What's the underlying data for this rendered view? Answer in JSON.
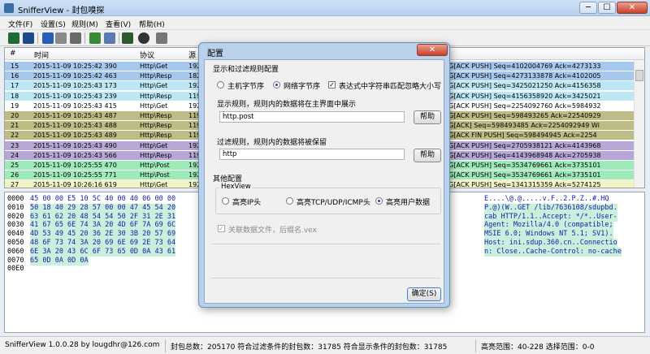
{
  "window": {
    "title": "SnifferView - 封包嗅探",
    "min": "─",
    "max": "☐",
    "close": "✕"
  },
  "menu": [
    "文件(F)",
    "设置(S)",
    "规则(M)",
    "查看(V)",
    "帮助(H)"
  ],
  "list": {
    "headers": {
      "no": "#",
      "time": "时间",
      "proto": "协议",
      "src": "源",
      "info": "内容"
    },
    "rows": [
      {
        "no": "15",
        "time": "2015-11-09 10:25:42 390",
        "proto": "Http\\Get",
        "src": "192",
        "info": "Tcp FLAG[ACK PUSH] Seq=4102004769 Ack=4273133",
        "bg": "#a6c8ee"
      },
      {
        "no": "16",
        "time": "2015-11-09 10:25:42 463",
        "proto": "Http\\Resp",
        "src": "182",
        "info": "Tcp FLAG[ACK PUSH] Seq=4273133878 Ack=4102005",
        "bg": "#a6c8ee"
      },
      {
        "no": "17",
        "time": "2015-11-09 10:25:43 173",
        "proto": "Http\\Get",
        "src": "192",
        "info": "Tcp FLAG[ACK PUSH] Seq=3425021250 Ack=4156358",
        "bg": "#bde7f5"
      },
      {
        "no": "18",
        "time": "2015-11-09 10:25:43 239",
        "proto": "Http\\Resp",
        "src": "119",
        "info": "Tcp FLAG[ACK PUSH] Seq=4156358920 Ack=3425021",
        "bg": "#bde7f5"
      },
      {
        "no": "19",
        "time": "2015-11-09 10:25:43 415",
        "proto": "Http\\Get",
        "src": "192",
        "info": "Tcp FLAG[ACK PUSH] Seq=2254092760 Ack=5984932",
        "bg": "#ffffff"
      },
      {
        "no": "20",
        "time": "2015-11-09 10:25:43 487",
        "proto": "Http\\Resp",
        "src": "119",
        "info": "Tcp FLAG[ACK PUSH] Seq=598493265 Ack=22540929",
        "bg": "#bdbc84"
      },
      {
        "no": "21",
        "time": "2015-11-09 10:25:43 488",
        "proto": "Http\\Resp",
        "src": "119",
        "info": "Tcp FLAG[ACK] Seq=598493485 Ack=2254092949 Wi",
        "bg": "#bdbc84"
      },
      {
        "no": "22",
        "time": "2015-11-09 10:25:43 489",
        "proto": "Http\\Resp",
        "src": "119",
        "info": "Tcp FLAG[ACK FIN PUSH] Seq=598494945 Ack=2254",
        "bg": "#bdbc84"
      },
      {
        "no": "23",
        "time": "2015-11-09 10:25:43 490",
        "proto": "Http\\Get",
        "src": "192",
        "info": "Tcp FLAG[ACK PUSH] Seq=2705938121 Ack=4143968",
        "bg": "#b6a7d6"
      },
      {
        "no": "24",
        "time": "2015-11-09 10:25:43 566",
        "proto": "Http\\Resp",
        "src": "119",
        "info": "Tcp FLAG[ACK PUSH] Seq=4143968948 Ack=2705938",
        "bg": "#b6a7d6"
      },
      {
        "no": "25",
        "time": "2015-11-09 10:25:55 470",
        "proto": "Http\\Post",
        "src": "192",
        "info": "Tcp FLAG[ACK PUSH] Seq=3534769661 Ack=3735101",
        "bg": "#9eeab9"
      },
      {
        "no": "26",
        "time": "2015-11-09 10:25:55 771",
        "proto": "Http\\Post",
        "src": "192",
        "info": "Tcp FLAG[ACK PUSH] Seq=3534769661 Ack=3735101",
        "bg": "#9eeab9"
      },
      {
        "no": "27",
        "time": "2015-11-09 10:26:16 619",
        "proto": "Http\\Get",
        "src": "192",
        "info": "Tcp FLAG[ACK PUSH] Seq=1341315359 Ack=5274125",
        "bg": "#f1f5c6"
      }
    ]
  },
  "hex": {
    "lines": [
      {
        "off": "0000",
        "bytes": "45 00 00 E5 10 5C 40 00 40 06 00 00",
        "ascii": "E....\\@.@.....v.F..2.P.Z..#.HQ"
      },
      {
        "off": "0010",
        "bytes": "50 18 40 29 28 57 00 00 47 45 54 20",
        "ascii": "P.@)(W..GET /lib/7636108/sdupbd."
      },
      {
        "off": "0020",
        "bytes": "63 61 62 20 48 54 54 50 2F 31 2E 31",
        "ascii": "cab HTTP/1.1..Accept: */*..User-"
      },
      {
        "off": "0030",
        "bytes": "41 67 65 6E 74 3A 20 4D 6F 7A 69 6C",
        "ascii": "Agent: Mozilla/4.0 (compatible;"
      },
      {
        "off": "0040",
        "bytes": "4D 53 49 45 20 36 2E 30 3B 20 57 69",
        "ascii": "MSIE 6.0; Windows NT 5.1; SV1)."
      },
      {
        "off": "0050",
        "bytes": "48 6F 73 74 3A 20 69 6E 69 2E 73 64",
        "ascii": "Host: ini.sdup.360.cn..Connectio"
      },
      {
        "off": "0060",
        "bytes": "6E 3A 20 43 6C 6F 73 65 0D 0A 43 61",
        "ascii": "n: Close..Cache-Control: no-cache"
      },
      {
        "off": "0070",
        "bytes": "65 0D 0A 0D 0A",
        "ascii": ""
      },
      {
        "off": "00E0",
        "bytes": "",
        "ascii": ""
      }
    ]
  },
  "status": {
    "app": "SnifferView   1.0.0.28   by   lougdhr@126.com",
    "total": "封包总数：205170   符合过滤条件的封包数：31785   符合显示条件的封包数：31785",
    "range": "高亮范围：40-228   选择范围：0-0"
  },
  "dialog": {
    "title": "配置",
    "close": "✕",
    "section1": "显示和过滤规则配置",
    "byte_order_host": "主机字节序",
    "byte_order_net": "网络字节序",
    "ignore_case": "表达式中字符串匹配忽略大小写",
    "show_rule_label": "显示规则，规则内的数据将在主界面中展示",
    "show_rule_value": "http.post",
    "filter_rule_label": "过滤规则，规则内的数据将被保留",
    "filter_rule_value": "http",
    "help": "帮助",
    "section2": "其他配置",
    "hexview_group": "HexView",
    "hl_ip": "高亮IP头",
    "hl_tcp": "高亮TCP/UDP/ICMP头",
    "hl_user": "高亮用户数据",
    "assoc": "关联数据文件，后缀名.vex",
    "ok": "确定(S)"
  }
}
